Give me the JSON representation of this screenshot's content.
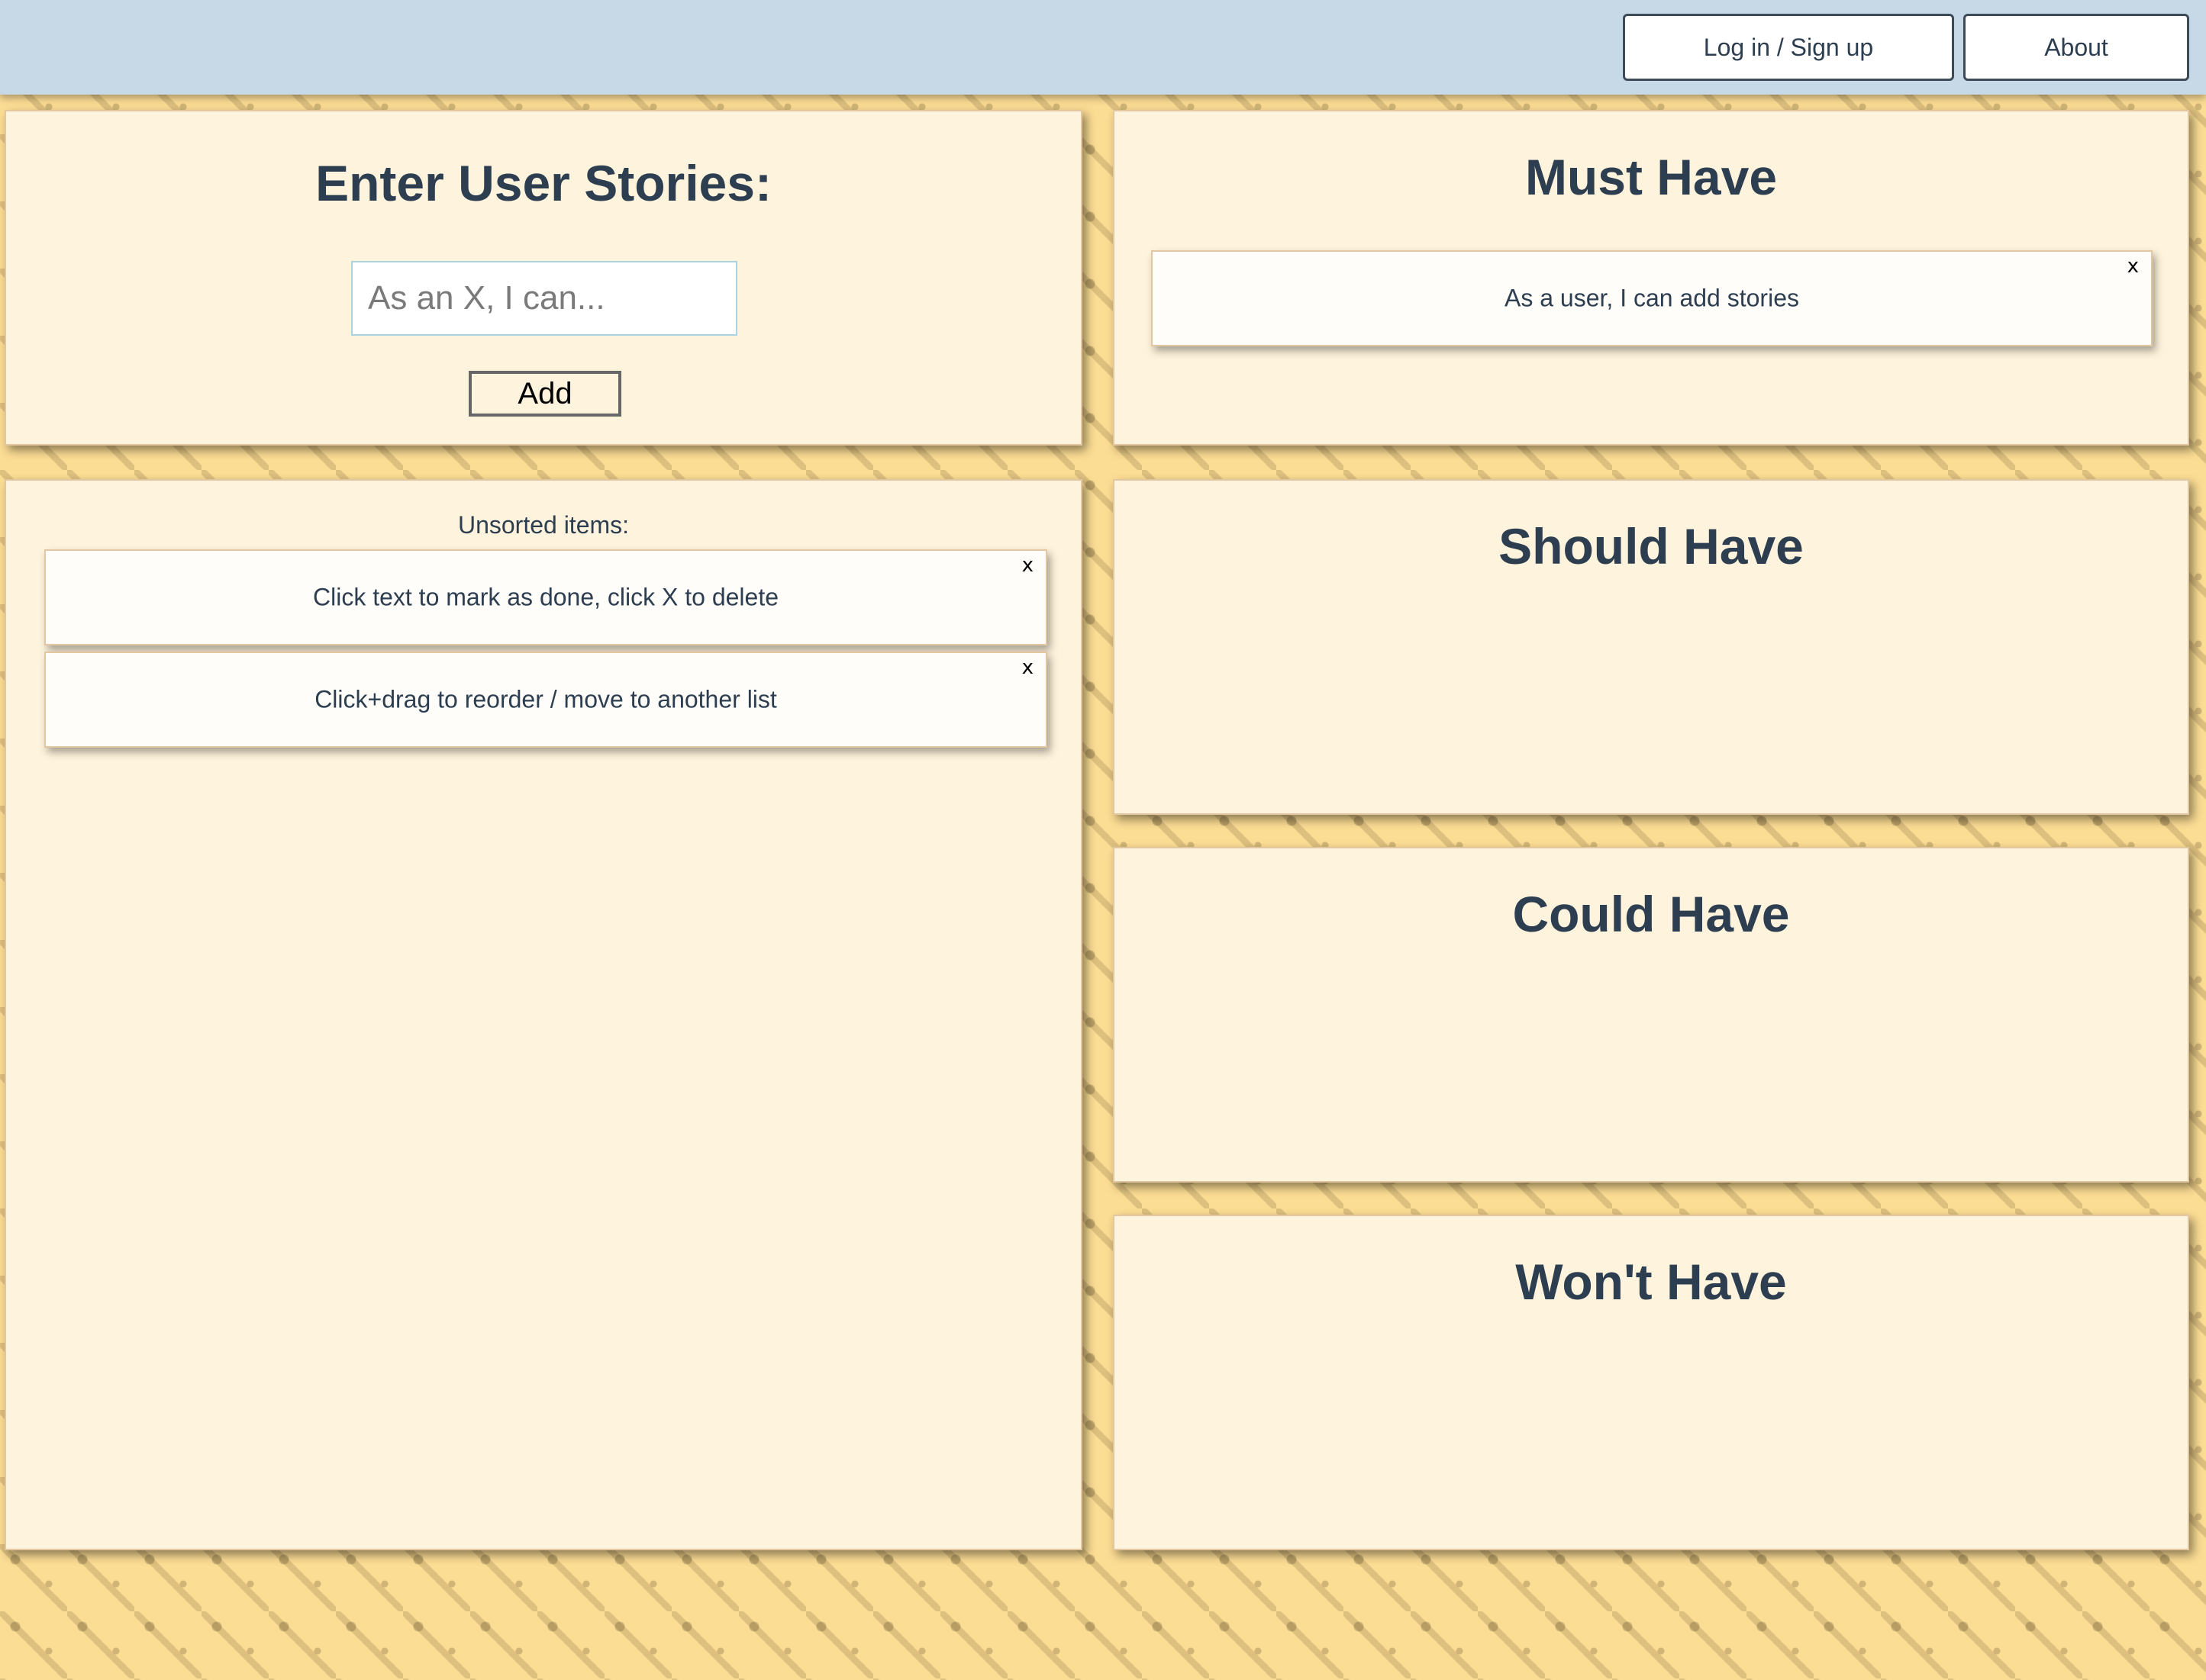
{
  "header": {
    "login_label": "Log in / Sign up",
    "about_label": "About"
  },
  "entry": {
    "title": "Enter User Stories:",
    "input_placeholder": "As an X, I can...",
    "input_value": "",
    "add_label": "Add"
  },
  "unsorted": {
    "label": "Unsorted items:",
    "items": [
      {
        "text": "Click text to mark as done, click X to delete",
        "delete": "x"
      },
      {
        "text": "Click+drag to reorder / move to another list",
        "delete": "x"
      }
    ]
  },
  "columns": {
    "must": {
      "title": "Must Have",
      "items": [
        {
          "text": "As a user, I can add stories",
          "delete": "x"
        }
      ]
    },
    "should": {
      "title": "Should Have",
      "items": []
    },
    "could": {
      "title": "Could Have",
      "items": []
    },
    "wont": {
      "title": "Won't Have",
      "items": []
    }
  },
  "colors": {
    "header_bg": "#c7d9e6",
    "panel_bg": "#fef3dc",
    "page_bg": "#fcdd94",
    "title_text": "#2c3e50"
  }
}
